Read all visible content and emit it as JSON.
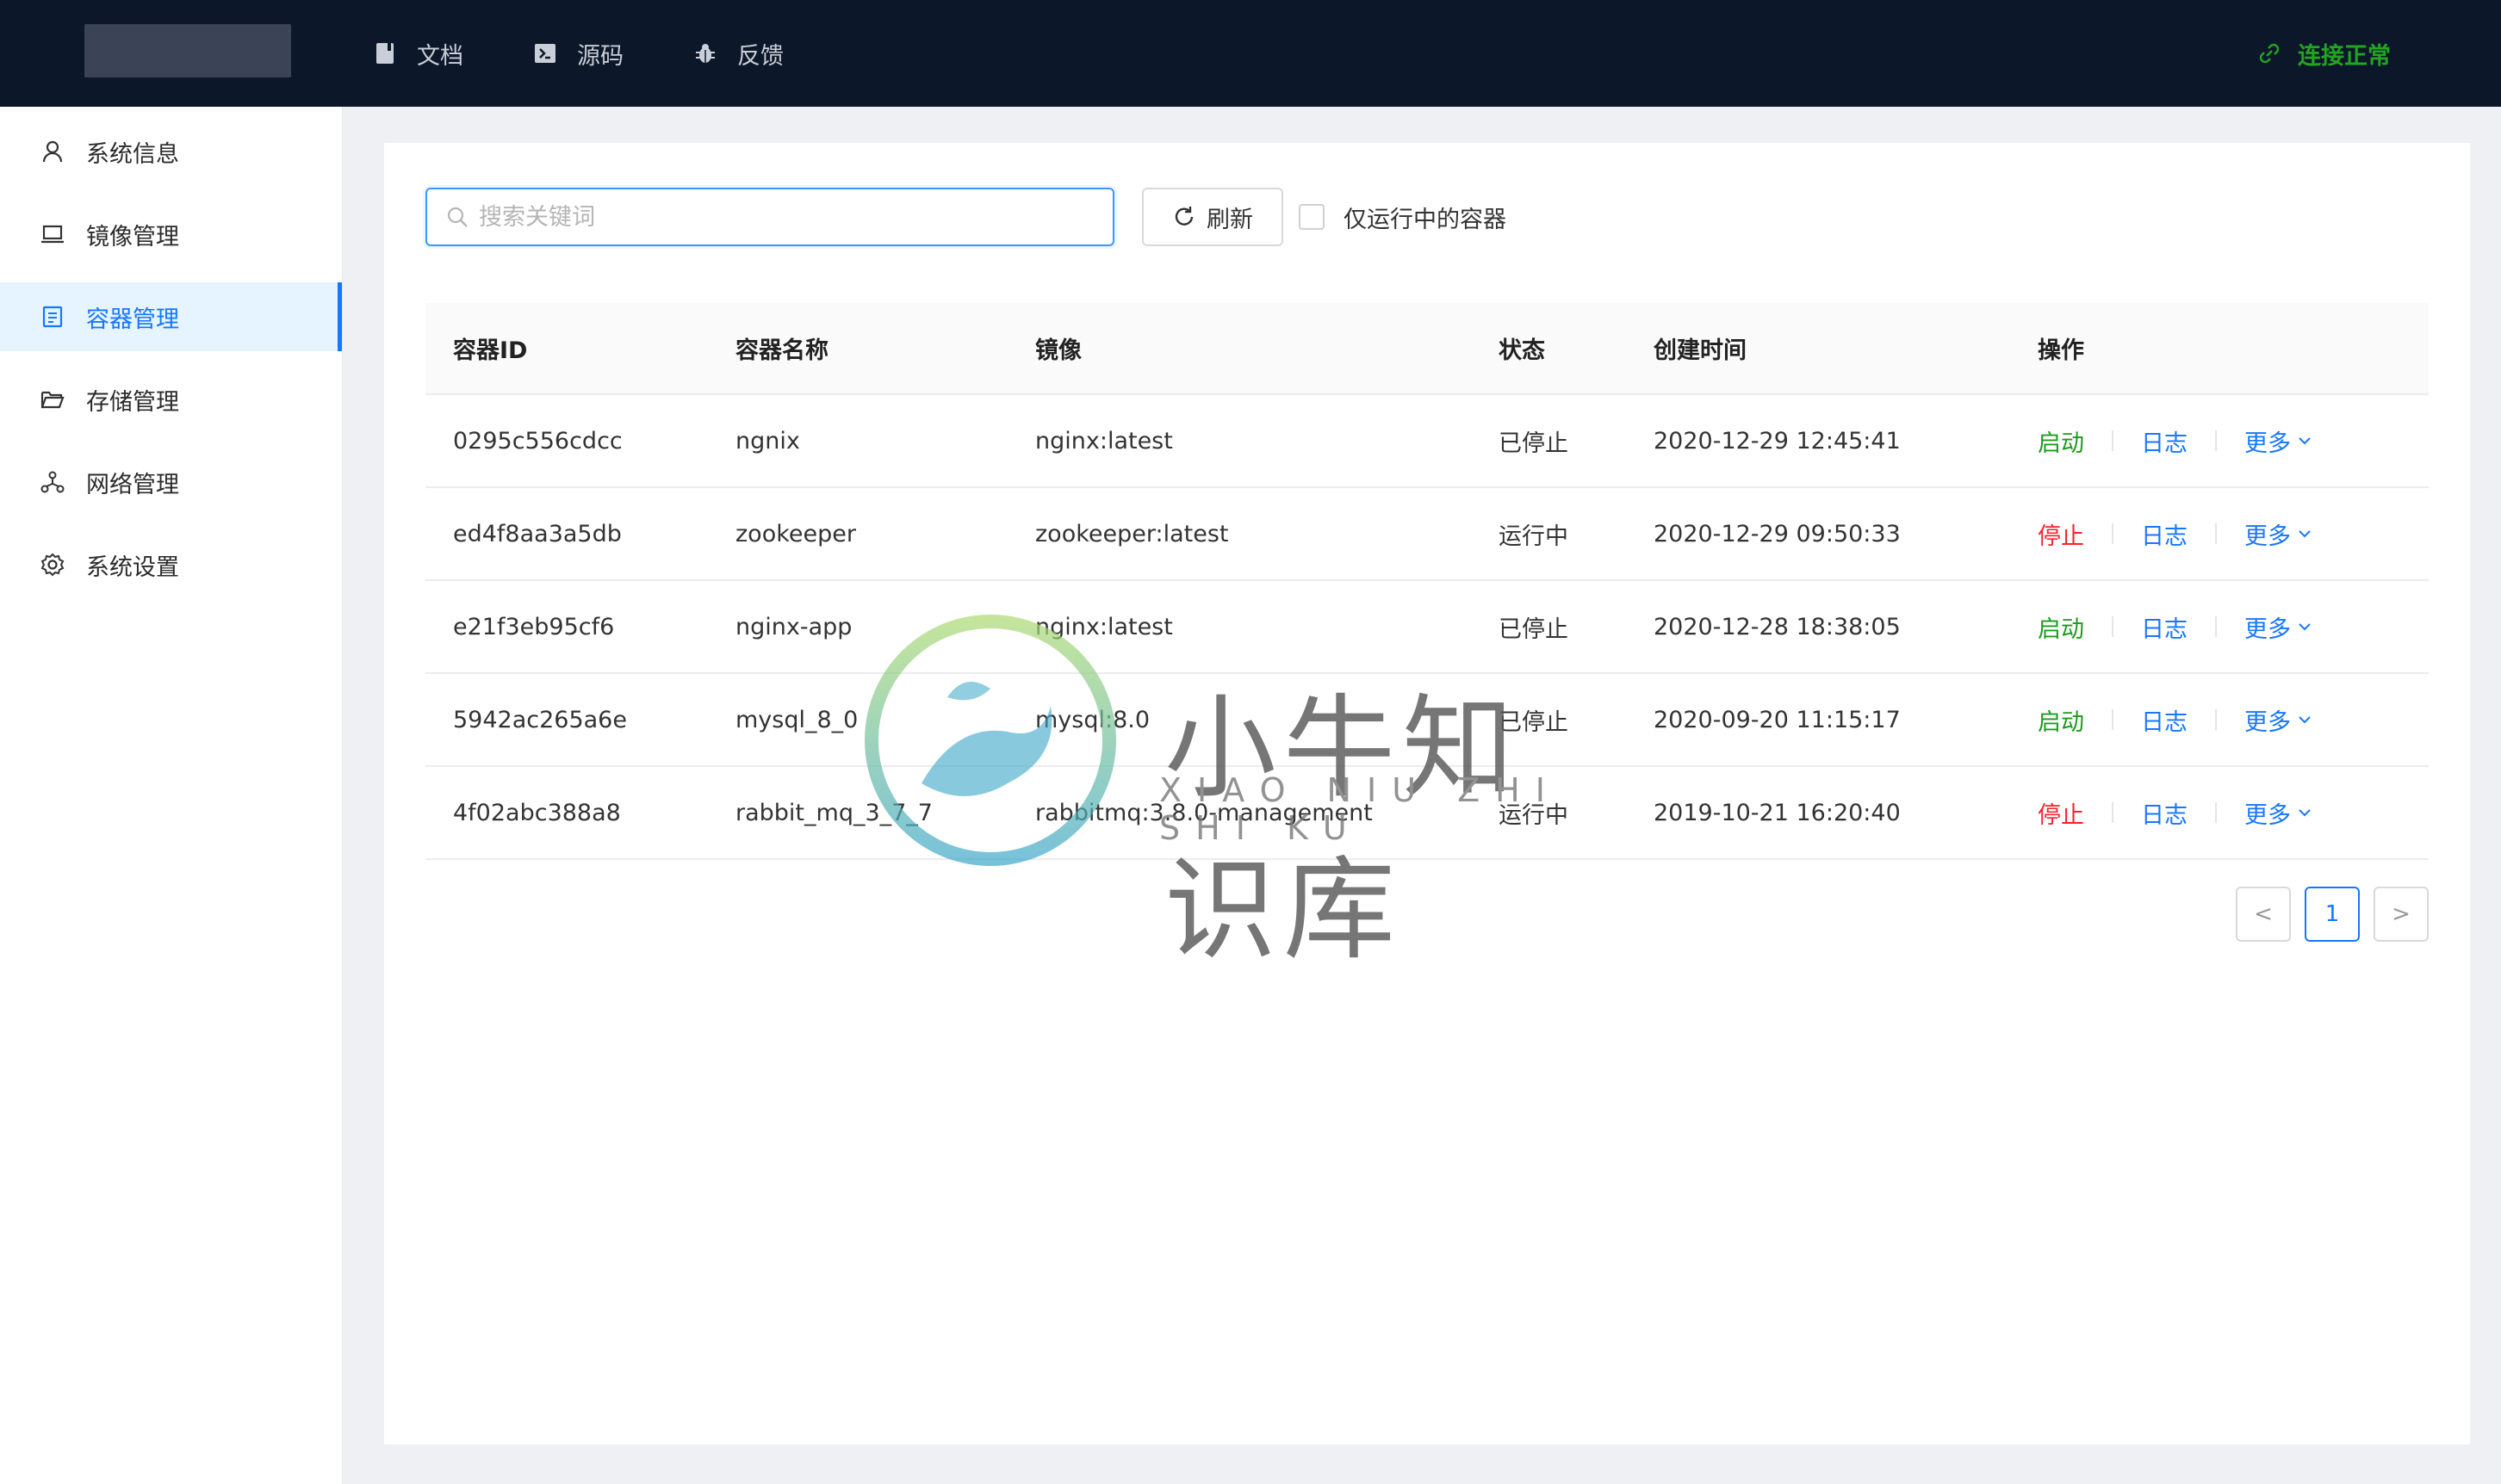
{
  "topbar": {
    "nav": [
      {
        "label": "文档",
        "icon": "book-icon"
      },
      {
        "label": "源码",
        "icon": "terminal-icon"
      },
      {
        "label": "反馈",
        "icon": "bug-icon"
      }
    ],
    "status": {
      "label": "连接正常",
      "icon": "link-icon",
      "color": "#22a322"
    }
  },
  "sidebar": {
    "items": [
      {
        "label": "系统信息",
        "icon": "user-icon",
        "active": false
      },
      {
        "label": "镜像管理",
        "icon": "laptop-icon",
        "active": false
      },
      {
        "label": "容器管理",
        "icon": "container-icon",
        "active": true
      },
      {
        "label": "存储管理",
        "icon": "folder-icon",
        "active": false
      },
      {
        "label": "网络管理",
        "icon": "network-icon",
        "active": false
      },
      {
        "label": "系统设置",
        "icon": "gear-icon",
        "active": false
      }
    ]
  },
  "toolbar": {
    "search_placeholder": "搜索关键词",
    "search_value": "",
    "refresh_label": "刷新",
    "only_running_label": "仅运行中的容器",
    "only_running_checked": false
  },
  "table": {
    "headers": [
      "容器ID",
      "容器名称",
      "镜像",
      "状态",
      "创建时间",
      "操作"
    ],
    "rows": [
      {
        "id": "0295c556cdcc",
        "name": "ngnix",
        "image": "nginx:latest",
        "status": "已停止",
        "created": "2020-12-29 12:45:41",
        "action": "启动",
        "action_color": "green",
        "log": "日志",
        "more": "更多"
      },
      {
        "id": "ed4f8aa3a5db",
        "name": "zookeeper",
        "image": "zookeeper:latest",
        "status": "运行中",
        "created": "2020-12-29 09:50:33",
        "action": "停止",
        "action_color": "red",
        "log": "日志",
        "more": "更多"
      },
      {
        "id": "e21f3eb95cf6",
        "name": "nginx-app",
        "image": "nginx:latest",
        "status": "已停止",
        "created": "2020-12-28 18:38:05",
        "action": "启动",
        "action_color": "green",
        "log": "日志",
        "more": "更多"
      },
      {
        "id": "5942ac265a6e",
        "name": "mysql_8_0",
        "image": "mysql:8.0",
        "status": "已停止",
        "created": "2020-09-20 11:15:17",
        "action": "启动",
        "action_color": "green",
        "log": "日志",
        "more": "更多"
      },
      {
        "id": "4f02abc388a8",
        "name": "rabbit_mq_3_7_7",
        "image": "rabbitmq:3.8.0-management",
        "status": "运行中",
        "created": "2019-10-21 16:20:40",
        "action": "停止",
        "action_color": "red",
        "log": "日志",
        "more": "更多"
      }
    ]
  },
  "pagination": {
    "prev": "<",
    "current": "1",
    "next": ">"
  },
  "watermark": {
    "title": "小牛知识库",
    "subtitle": "XIAO NIU ZHI SHI KU"
  },
  "colors": {
    "accent": "#1677ff",
    "start": "#1e9b1e",
    "stop": "#f5222d",
    "topbar": "#0c1729"
  }
}
